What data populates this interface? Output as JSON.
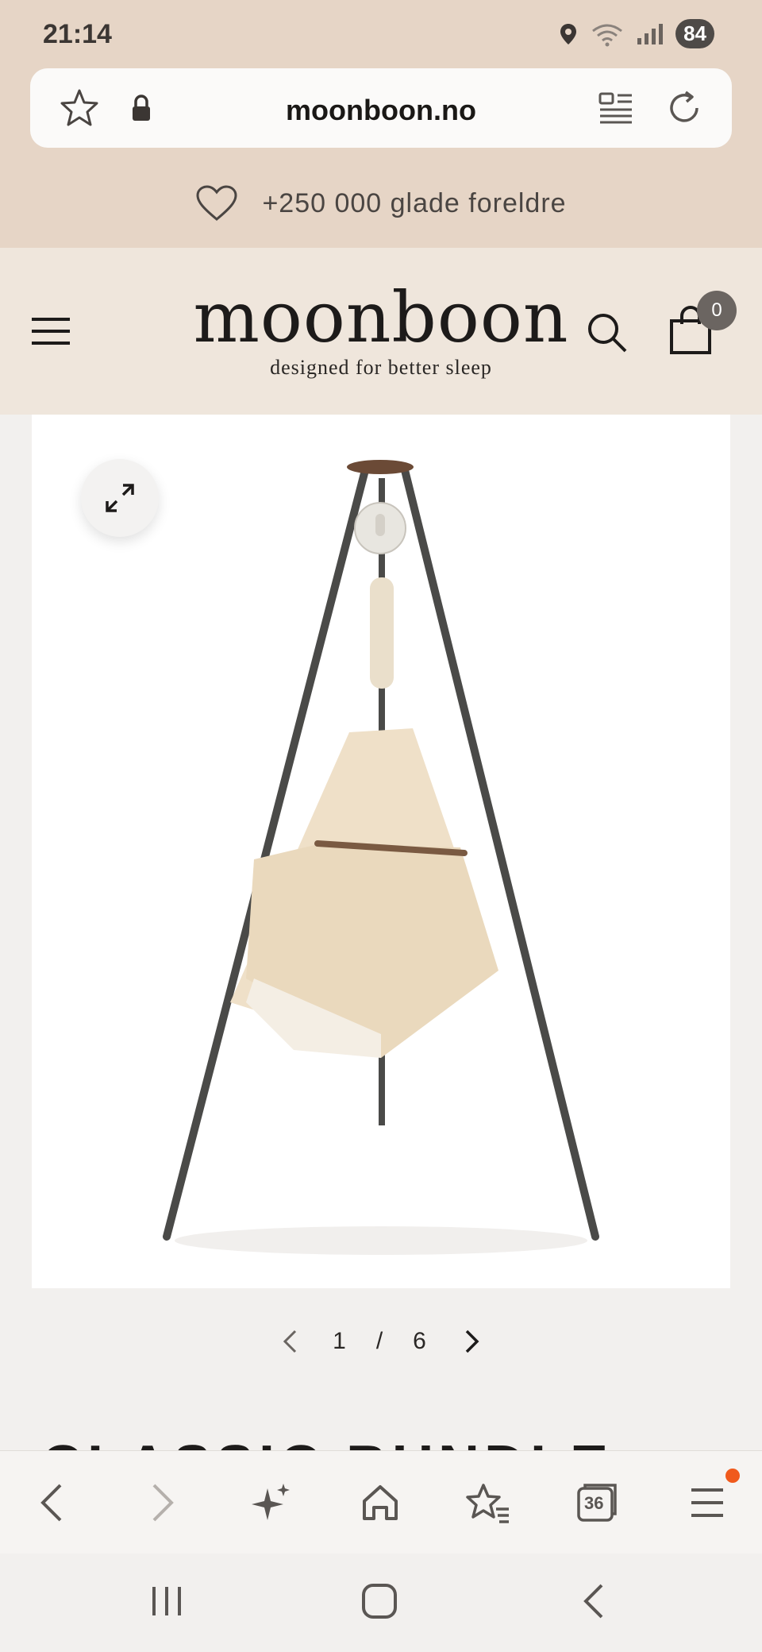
{
  "status_bar": {
    "time": "21:14",
    "battery": "84",
    "icons": [
      "location-icon",
      "wifi-icon",
      "signal-icon"
    ]
  },
  "browser": {
    "url": "moonboon.no",
    "left_icons": [
      "star-icon",
      "lock-icon"
    ],
    "right_icons": [
      "reader-mode-icon",
      "reload-icon"
    ]
  },
  "promo": {
    "icon": "heart-icon",
    "text": "+250 000 glade foreldre"
  },
  "header": {
    "logo_word": "moonboon",
    "tagline": "designed for better sleep",
    "cart_count": "0",
    "icons": [
      "menu-icon",
      "search-icon",
      "cart-icon"
    ]
  },
  "product_gallery": {
    "image_description_icon": "bouncer-hammock-on-tripod",
    "current": "1",
    "separator": "/",
    "total": "6"
  },
  "product": {
    "title_partial": "CLASSIC BUNDLE"
  },
  "toolbar": {
    "tabs_count": "36",
    "icons": [
      "back-icon",
      "forward-icon",
      "ai-sparkle-icon",
      "home-icon",
      "bookmarks-icon",
      "tabs-icon",
      "menu-icon"
    ]
  },
  "colors": {
    "browser_bg": "#e6d5c6",
    "header_bg": "#efe6dc",
    "page_bg": "#f2f0ee",
    "notification": "#f05a1c"
  }
}
